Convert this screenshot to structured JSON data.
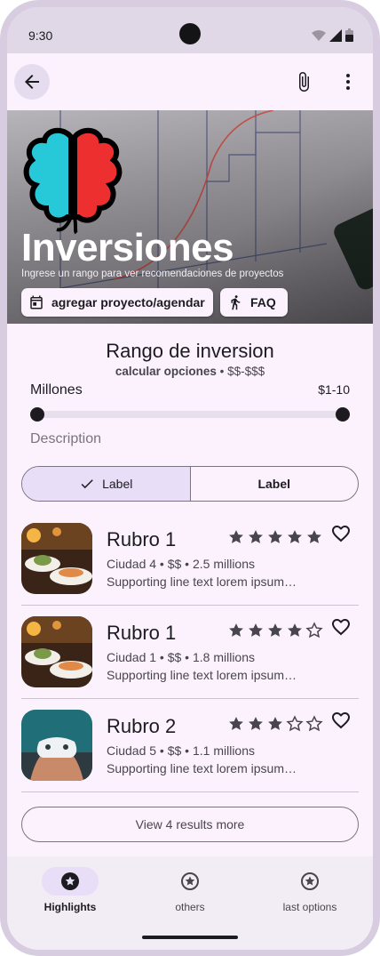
{
  "status_bar": {
    "time": "9:30"
  },
  "hero": {
    "title": "Inversiones",
    "subtitle": "Ingrese un rango para ver recomendaciones de proyectos",
    "chips": [
      "agregar proyecto/agendar",
      "FAQ"
    ]
  },
  "range": {
    "title": "Rango de inversion",
    "subtitle_bold": "calcular opciones",
    "subtitle_rest": " • $$-$$$",
    "slider_label": "Millones",
    "slider_value": "$1-10",
    "description": "Description"
  },
  "segmented": {
    "left_label": "Label",
    "right_label": "Label"
  },
  "items": [
    {
      "title": "Rubro 1",
      "meta": "Ciudad 4 • $$ • 2.5 millions",
      "support": "Supporting line text lorem ipsum…",
      "rating": 5
    },
    {
      "title": "Rubro 1",
      "meta": "Ciudad 1 • $$ • 1.8 millions",
      "support": "Supporting line text lorem ipsum…",
      "rating": 4
    },
    {
      "title": "Rubro 2",
      "meta": "Ciudad 5 • $$ • 1.1 millions",
      "support": "Supporting line text lorem ipsum…",
      "rating": 3
    }
  ],
  "more_button": "View 4 results more",
  "nav": [
    {
      "label": "Highlights",
      "active": true
    },
    {
      "label": "others",
      "active": false
    },
    {
      "label": "last options",
      "active": false
    }
  ],
  "colors": {
    "surface": "#fbf2fd",
    "primary_container": "#e8def8",
    "on_surface": "#1c1b1f",
    "logo_left": "#27c8d8",
    "logo_right": "#ee2f2f"
  }
}
